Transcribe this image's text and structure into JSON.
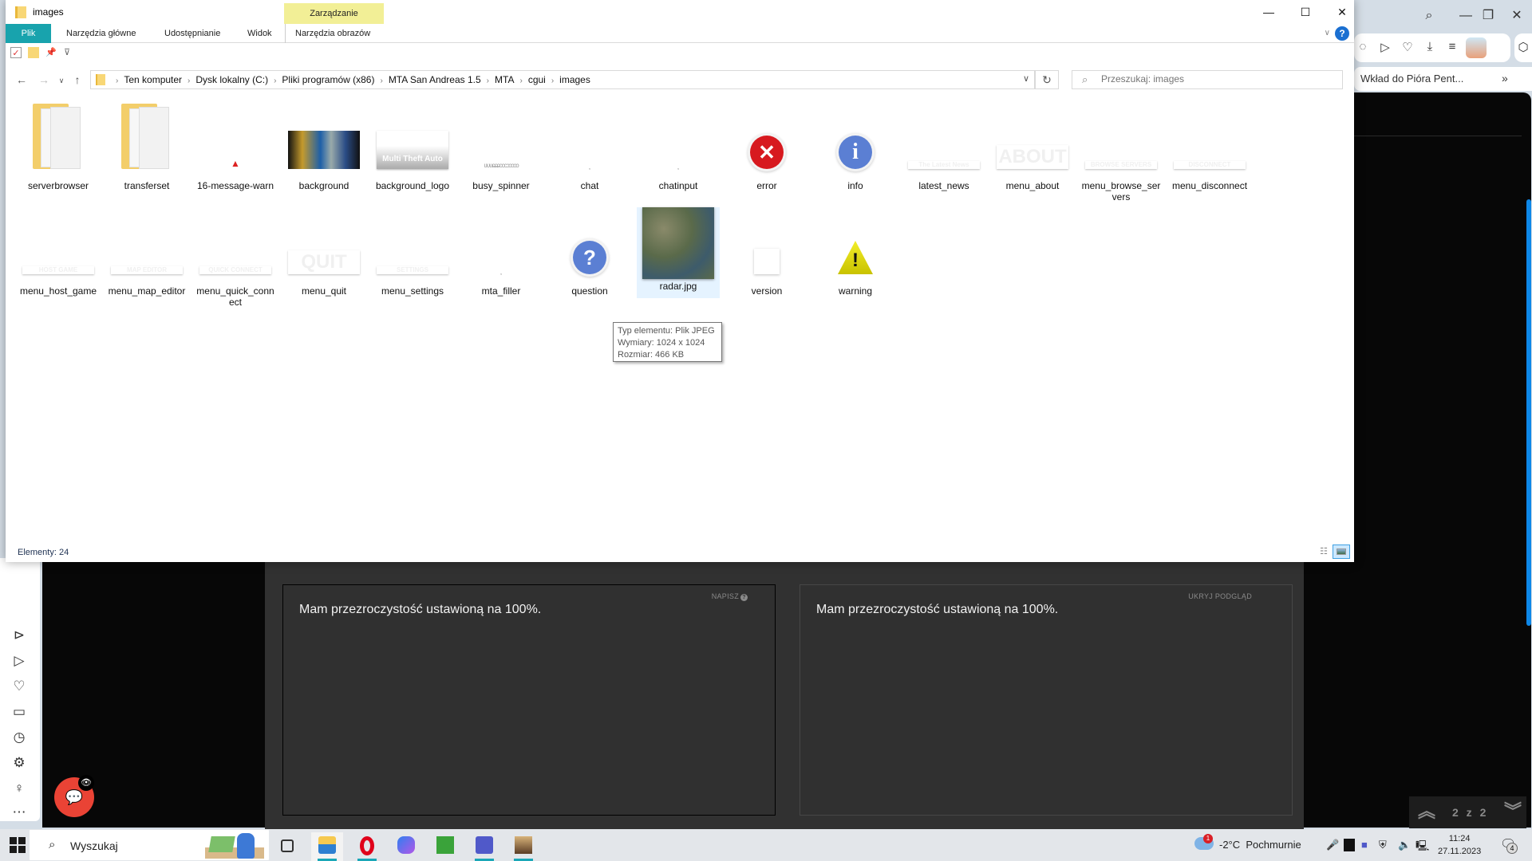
{
  "browser": {
    "controls": {
      "search": "⌕",
      "minimize": "—",
      "restore": "❐",
      "close": "✕"
    },
    "toolbar_icons": [
      "shield-icon",
      "send-icon",
      "heart-icon",
      "download-icon",
      "settings-sliders-icon",
      "extension-avatar",
      "box-icon"
    ],
    "bookmark": "Wkład do Pióra Pent...",
    "bookmarks_more": "»",
    "sidebar_icons": [
      "player-icon",
      "send-icon",
      "heart-icon",
      "cast-icon",
      "history-icon",
      "settings-icon",
      "lightbulb-icon",
      "more-icon"
    ],
    "editor": {
      "write_label": "NAPISZ",
      "write_help": "?",
      "preview_label": "UKRYJ PODGLĄD",
      "write_text": "Mam przezroczystość ustawioną na 100%.",
      "preview_text": "Mam przezroczystość ustawioną na 100%."
    },
    "pager": {
      "text": "2 z 2",
      "up": "︽",
      "down": "︾"
    },
    "scroll_position": 0.35
  },
  "explorer": {
    "title": "images",
    "context_group": "Zarządzanie",
    "ribbon_tabs": [
      {
        "label": "Plik",
        "active": true
      },
      {
        "label": "Narzędzia główne"
      },
      {
        "label": "Udostępnianie"
      },
      {
        "label": "Widok"
      },
      {
        "label": "Narzędzia obrazów"
      }
    ],
    "window_buttons": {
      "minimize": "—",
      "maximize": "☐",
      "close": "✕"
    },
    "breadcrumb": [
      "Ten komputer",
      "Dysk lokalny (C:)",
      "Pliki programów (x86)",
      "MTA San Andreas 1.5",
      "MTA",
      "cgui",
      "images"
    ],
    "search_placeholder": "Przeszukaj: images",
    "items": [
      {
        "name": "serverbrowser",
        "type": "folder"
      },
      {
        "name": "transferset",
        "type": "folder"
      },
      {
        "name": "16-message-warn",
        "type": "warn-small"
      },
      {
        "name": "background",
        "type": "background"
      },
      {
        "name": "background_logo",
        "type": "logo",
        "thumb_text": "Multi Theft Auto"
      },
      {
        "name": "busy_spinner",
        "type": "spinner"
      },
      {
        "name": "chat",
        "type": "dot"
      },
      {
        "name": "chatinput",
        "type": "dot"
      },
      {
        "name": "error",
        "type": "error"
      },
      {
        "name": "info",
        "type": "info"
      },
      {
        "name": "latest_news",
        "type": "menu",
        "thumb_text": "The Latest News"
      },
      {
        "name": "menu_about",
        "type": "menu-big",
        "thumb_text": "ABOUT"
      },
      {
        "name": "menu_browse_servers",
        "type": "menu",
        "thumb_text": "BROWSE SERVERS"
      },
      {
        "name": "menu_disconnect",
        "type": "menu",
        "thumb_text": "DISCONNECT"
      },
      {
        "name": "menu_host_game",
        "type": "menu",
        "thumb_text": "HOST GAME"
      },
      {
        "name": "menu_map_editor",
        "type": "menu",
        "thumb_text": "MAP EDITOR"
      },
      {
        "name": "menu_quick_connect",
        "type": "menu",
        "thumb_text": "QUICK CONNECT"
      },
      {
        "name": "menu_quit",
        "type": "menu-big",
        "thumb_text": "QUIT"
      },
      {
        "name": "menu_settings",
        "type": "menu",
        "thumb_text": "SETTINGS"
      },
      {
        "name": "mta_filler",
        "type": "dot"
      },
      {
        "name": "question",
        "type": "question"
      },
      {
        "name": "radar.jpg",
        "type": "radar",
        "selected": true
      },
      {
        "name": "version",
        "type": "blank"
      },
      {
        "name": "warning",
        "type": "warning"
      }
    ],
    "tooltip": [
      "Typ elementu: Plik JPEG",
      "Wymiary: 1024 x 1024",
      "Rozmiar: 466 KB"
    ],
    "status": "Elementy: 24"
  },
  "taskbar": {
    "search_placeholder": "Wyszukaj",
    "apps": [
      "task-view",
      "file-explorer",
      "opera",
      "copilot",
      "minecraft",
      "teams",
      "gta-sa"
    ],
    "weather": {
      "badge": "1",
      "temp": "-2°C",
      "condition": "Pochmurnie"
    },
    "time": "11:24",
    "date": "27.11.2023",
    "notifications": "4"
  }
}
